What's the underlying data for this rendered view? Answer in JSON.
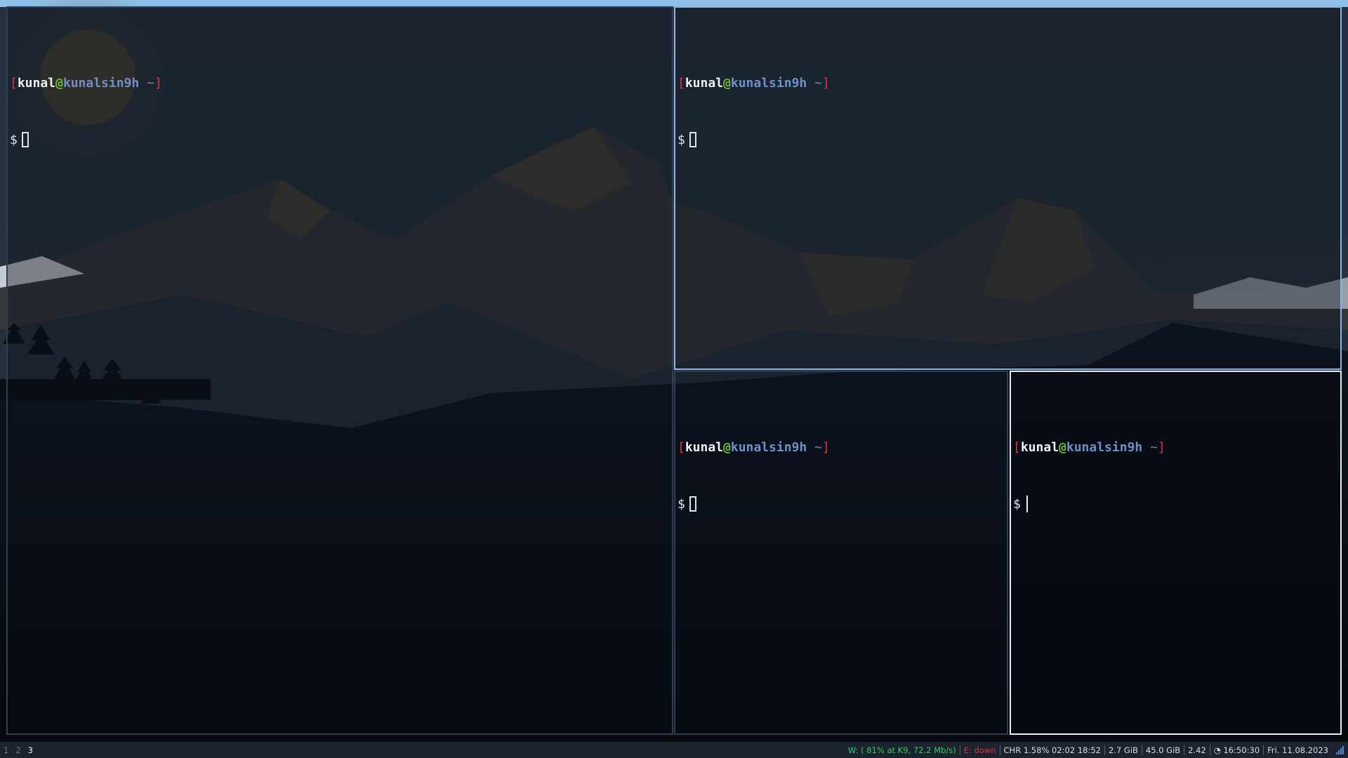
{
  "colors": {
    "bar_bg": "#1b2230",
    "wifi_good": "#2fd35a",
    "eth_down": "#e0323c",
    "prompt_bracket": "#e0323c",
    "prompt_user": "#f0f0f0",
    "prompt_at": "#6dbf3a",
    "prompt_host": "#6f8fc9"
  },
  "terminals": [
    {
      "prompt": {
        "open": "[",
        "user": "kunal",
        "at": "@",
        "host": "kunalsin9h",
        "dir": " ~",
        "close": "]"
      },
      "ps1": "$",
      "cursor": "block",
      "focused": false
    },
    {
      "prompt": {
        "open": "[",
        "user": "kunal",
        "at": "@",
        "host": "kunalsin9h",
        "dir": " ~",
        "close": "]"
      },
      "ps1": "$",
      "cursor": "block",
      "focused": false
    },
    {
      "prompt": {
        "open": "[",
        "user": "kunal",
        "at": "@",
        "host": "kunalsin9h",
        "dir": " ~",
        "close": "]"
      },
      "ps1": "$",
      "cursor": "block",
      "focused": false
    },
    {
      "prompt": {
        "open": "[",
        "user": "kunal",
        "at": "@",
        "host": "kunalsin9h",
        "dir": " ~",
        "close": "]"
      },
      "ps1": "$",
      "cursor": "bar",
      "focused": true
    }
  ],
  "bar": {
    "workspaces": [
      {
        "label": "1",
        "active": false
      },
      {
        "label": "2",
        "active": false
      },
      {
        "label": "3",
        "active": true
      }
    ],
    "status": {
      "wifi": "W: ( 81% at K9, 72.2 Mb/s)",
      "ethernet": "E: down",
      "battery": "CHR 1.58% 02:02 18:52",
      "memory": "2.7 GiB",
      "disk": "45.0 GiB",
      "load": "2.42",
      "time": "◔ 16:50:30",
      "date": "Fri. 11.08.2023"
    },
    "tray_icon": "signal-bars-icon"
  }
}
